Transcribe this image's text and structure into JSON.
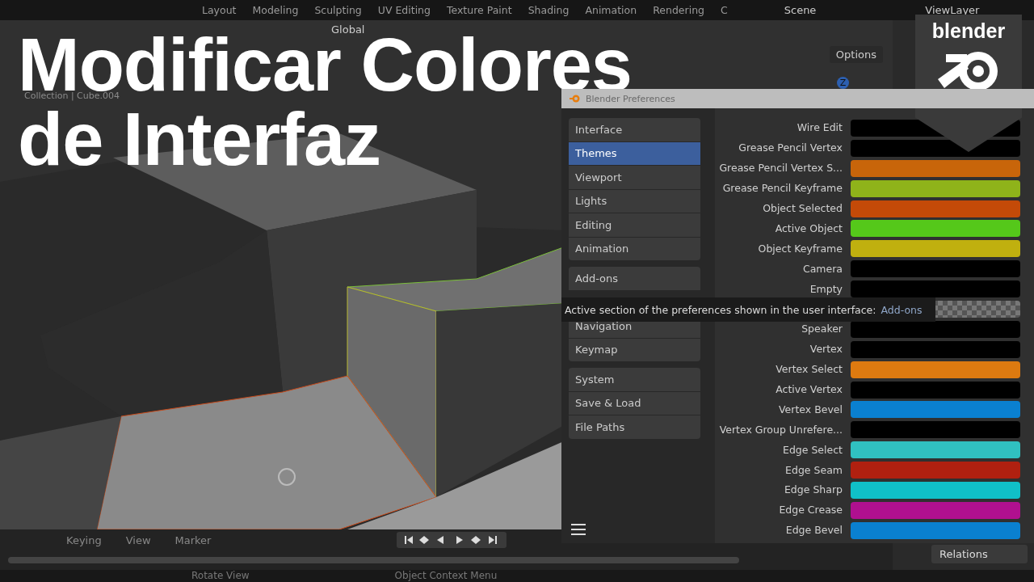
{
  "title": {
    "lines": [
      "Modificar Colores",
      "de Interfaz"
    ]
  },
  "topbar": {
    "workspaces": [
      {
        "label": "Layout",
        "selected": false
      },
      {
        "label": "Modeling",
        "selected": false
      },
      {
        "label": "Sculpting",
        "selected": false
      },
      {
        "label": "UV Editing",
        "selected": false
      },
      {
        "label": "Texture Paint",
        "selected": false
      },
      {
        "label": "Shading",
        "selected": false
      },
      {
        "label": "Animation",
        "selected": false
      },
      {
        "label": "Rendering",
        "selected": false
      },
      {
        "label": "C",
        "selected": false
      }
    ],
    "scene": "Scene",
    "view_layer": "ViewLayer"
  },
  "viewport": {
    "orientation": "Global",
    "options": "Options",
    "collection": "Collection | Cube.004",
    "axis_badge": "Z"
  },
  "preferences": {
    "title": "Blender Preferences",
    "sections": [
      [
        {
          "label": "Interface",
          "selected": false
        },
        {
          "label": "Themes",
          "selected": true
        },
        {
          "label": "Viewport",
          "selected": false
        },
        {
          "label": "Lights",
          "selected": false
        },
        {
          "label": "Editing",
          "selected": false
        },
        {
          "label": "Animation",
          "selected": false
        }
      ],
      [
        {
          "label": "Add-ons",
          "selected": false
        },
        {
          "label": "Navigation",
          "selected": false
        },
        {
          "label": "Keymap",
          "selected": false
        }
      ],
      [
        {
          "label": "System",
          "selected": false
        },
        {
          "label": "Save & Load",
          "selected": false
        },
        {
          "label": "File Paths",
          "selected": false
        }
      ]
    ],
    "colors": [
      {
        "label": "Wire Edit",
        "color": "#000000"
      },
      {
        "label": "Grease Pencil Vertex",
        "color": "#000000"
      },
      {
        "label": "Grease Pencil Vertex S...",
        "color": "#c8650a"
      },
      {
        "label": "Grease Pencil Keyframe",
        "color": "#8fb31a"
      },
      {
        "label": "Object Selected",
        "color": "#c44a08"
      },
      {
        "label": "Active Object",
        "color": "#55c81a"
      },
      {
        "label": "Object Keyframe",
        "color": "#c0b00f"
      },
      {
        "label": "Camera",
        "color": "#000000"
      },
      {
        "label": "Empty",
        "color": "#000000"
      },
      {
        "kind": "alpha"
      },
      {
        "label": "Speaker",
        "color": "#000000"
      },
      {
        "label": "Vertex",
        "color": "#000000"
      },
      {
        "label": "Vertex Select",
        "color": "#dd7a10"
      },
      {
        "label": "Active Vertex",
        "color": "#000000"
      },
      {
        "label": "Vertex Bevel",
        "color": "#0a80d0"
      },
      {
        "label": "Vertex Group Unrefere...",
        "color": "#000000"
      },
      {
        "label": "Edge Select",
        "color": "#30c0c0"
      },
      {
        "label": "Edge Seam",
        "color": "#b02010"
      },
      {
        "label": "Edge Sharp",
        "color": "#10c0c8"
      },
      {
        "label": "Edge Crease",
        "color": "#b0108f"
      },
      {
        "label": "Edge Bevel",
        "color": "#0a80d0"
      }
    ],
    "tooltip": {
      "text": "Active section of the preferences shown in the user interface:",
      "value": "Add-ons"
    }
  },
  "timeline": {
    "menus": [
      "Keying",
      "View",
      "Marker"
    ]
  },
  "properties": {
    "panel": "Relations"
  },
  "status_bar": [
    "Rotate View",
    "Object Context Menu"
  ],
  "logo": {
    "text": "blender"
  }
}
